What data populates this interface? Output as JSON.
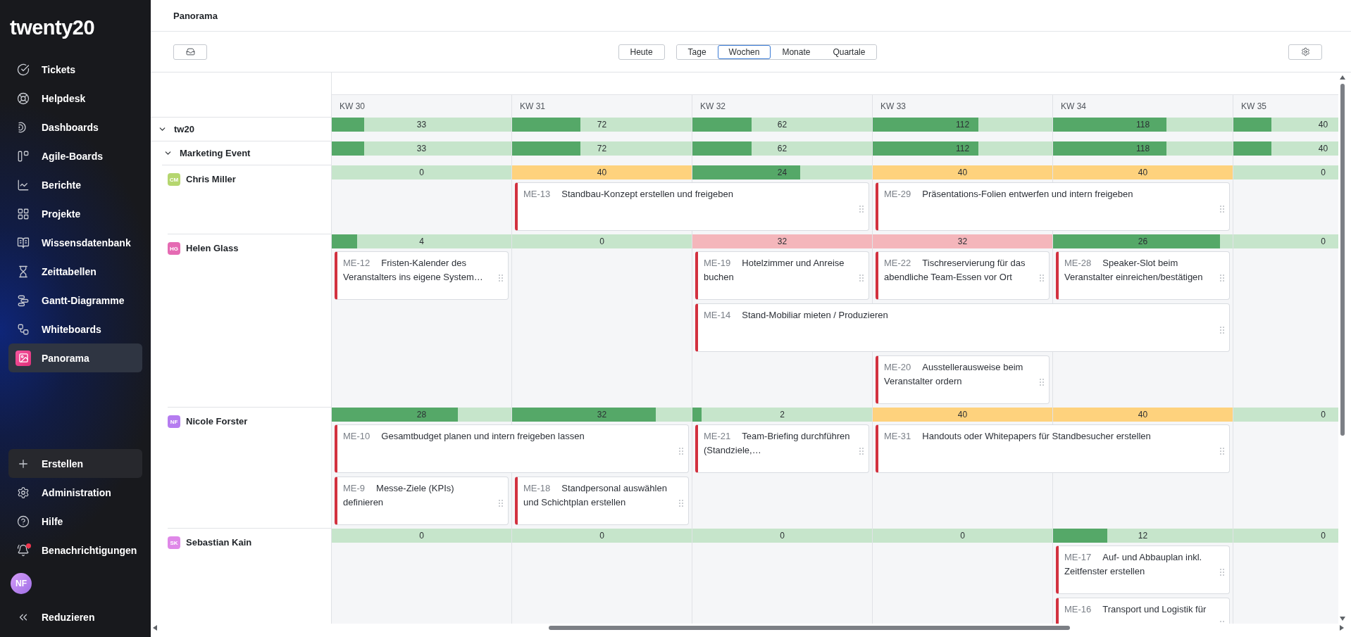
{
  "sidebar": {
    "logo": "twenty20",
    "nav": [
      {
        "label": "Tickets",
        "selected": false
      },
      {
        "label": "Helpdesk",
        "selected": false
      },
      {
        "label": "Dashboards",
        "selected": false
      },
      {
        "label": "Agile-Boards",
        "selected": false
      },
      {
        "label": "Berichte",
        "selected": false
      },
      {
        "label": "Projekte",
        "selected": false
      },
      {
        "label": "Wissensdatenbank",
        "selected": false
      },
      {
        "label": "Zeittabellen",
        "selected": false
      },
      {
        "label": "Gantt-Diagramme",
        "selected": false
      },
      {
        "label": "Whiteboards",
        "selected": false
      },
      {
        "label": "Panorama",
        "selected": true
      }
    ],
    "footer": [
      {
        "kind": "create",
        "label": "Erstellen",
        "unread": false
      },
      {
        "kind": "link",
        "label": "Administration",
        "unread": false
      },
      {
        "kind": "link",
        "label": "Hilfe",
        "unread": false
      },
      {
        "kind": "link",
        "label": "Benachrichtigungen",
        "unread": true
      }
    ],
    "user": {
      "initials": "NF"
    },
    "collapse": {
      "label": "Reduzieren"
    }
  },
  "header": {
    "title": "Panorama"
  },
  "toolbar": {
    "today": "Heute",
    "scales": [
      {
        "label": "Tage",
        "selected": false
      },
      {
        "label": "Wochen",
        "selected": true
      },
      {
        "label": "Monate",
        "selected": false
      },
      {
        "label": "Quartale",
        "selected": false
      }
    ]
  },
  "timeline": {
    "weeks": [
      "KW 30",
      "KW 31",
      "KW 32",
      "KW 33",
      "KW 34",
      "KW 35"
    ],
    "tree": [
      {
        "kind": "group",
        "label": "tw20",
        "expanded": true,
        "load": [
          {
            "value": "33",
            "color": "#c6e5cb",
            "level": 0.18
          },
          {
            "value": "72",
            "color": "#c6e5cb",
            "level": 0.38
          },
          {
            "value": "62",
            "color": "#c6e5cb",
            "level": 0.33
          },
          {
            "value": "112",
            "color": "#c6e5cb",
            "level": 0.59
          },
          {
            "value": "118",
            "color": "#c6e5cb",
            "level": 0.63
          },
          {
            "value": "40",
            "color": "#c6e5cb",
            "level": 0.21
          }
        ],
        "children": [
          {
            "kind": "group",
            "label": "Marketing Event",
            "expanded": true,
            "load": [
              {
                "value": "33",
                "color": "#c6e5cb",
                "level": 0.18
              },
              {
                "value": "72",
                "color": "#c6e5cb",
                "level": 0.38
              },
              {
                "value": "62",
                "color": "#c6e5cb",
                "level": 0.33
              },
              {
                "value": "112",
                "color": "#c6e5cb",
                "level": 0.59
              },
              {
                "value": "118",
                "color": "#c6e5cb",
                "level": 0.63
              },
              {
                "value": "40",
                "color": "#c6e5cb",
                "level": 0.21
              }
            ],
            "children": [
              {
                "kind": "person",
                "name": "Chris Miller",
                "initials": "CM",
                "color": "#b5d66f",
                "load": [
                  {
                    "value": "0",
                    "color": "#c6e5cb"
                  },
                  {
                    "value": "40",
                    "color": "#fed27d"
                  },
                  {
                    "value": "24",
                    "color": "#c6e5cb",
                    "level": 0.6
                  },
                  {
                    "value": "40",
                    "color": "#fed27d"
                  },
                  {
                    "value": "40",
                    "color": "#fed27d"
                  },
                  {
                    "value": "0",
                    "color": "#c6e5cb"
                  }
                ],
                "lanes": [
                  [
                    {
                      "kind": "empty"
                    },
                    {
                      "kind": "task",
                      "key": "ME-13",
                      "title": "Standbau-Konzept erstellen und freigeben"
                    },
                    {
                      "kind": "continued"
                    },
                    {
                      "kind": "task",
                      "key": "ME-29",
                      "title": "Präsentations-Folien entwerfen und intern freigeben"
                    },
                    {
                      "kind": "continued"
                    }
                  ]
                ]
              },
              {
                "kind": "person",
                "name": "Helen Glass",
                "initials": "HG",
                "color": "#e56bb3",
                "load": [
                  {
                    "value": "4",
                    "color": "#c6e5cb",
                    "level": 0.14
                  },
                  {
                    "value": "0",
                    "color": "#c6e5cb"
                  },
                  {
                    "value": "32",
                    "color": "#f4b6bb"
                  },
                  {
                    "value": "32",
                    "color": "#f4b6bb"
                  },
                  {
                    "value": "26",
                    "color": "#c6e5cb",
                    "level": 0.93
                  },
                  {
                    "value": "0",
                    "color": "#c6e5cb"
                  }
                ],
                "lanes": [
                  [
                    {
                      "kind": "task",
                      "key": "ME-12",
                      "title": "Fristen-Kalender des Veranstalters ins eigene System…"
                    },
                    {
                      "kind": "empty"
                    },
                    {
                      "kind": "task",
                      "key": "ME-19",
                      "title": "Hotelzimmer und Anreise buchen"
                    },
                    {
                      "kind": "task",
                      "key": "ME-22",
                      "title": "Tischreservierung für das abendliche Team-Essen vor Ort"
                    },
                    {
                      "kind": "task",
                      "key": "ME-28",
                      "title": "Speaker-Slot beim Veranstalter einreichen/bestätigen"
                    }
                  ],
                  [
                    {
                      "kind": "empty"
                    },
                    {
                      "kind": "empty"
                    },
                    {
                      "kind": "task",
                      "key": "ME-14",
                      "title": "Stand-Mobiliar mieten / Produzieren"
                    },
                    {
                      "kind": "continued"
                    },
                    {
                      "kind": "continued"
                    }
                  ],
                  [
                    {
                      "kind": "empty"
                    },
                    {
                      "kind": "empty"
                    },
                    {
                      "kind": "empty"
                    },
                    {
                      "kind": "task",
                      "key": "ME-20",
                      "title": "Ausstellerausweise beim Veranstalter ordern"
                    }
                  ]
                ]
              },
              {
                "kind": "person",
                "name": "Nicole Forster",
                "initials": "NF",
                "color": "#b57cf0",
                "load": [
                  {
                    "value": "28",
                    "color": "#c6e5cb",
                    "level": 0.7
                  },
                  {
                    "value": "32",
                    "color": "#c6e5cb",
                    "level": 0.8
                  },
                  {
                    "value": "2",
                    "color": "#c6e5cb",
                    "level": 0.05
                  },
                  {
                    "value": "40",
                    "color": "#fed27d"
                  },
                  {
                    "value": "40",
                    "color": "#fed27d"
                  },
                  {
                    "value": "0",
                    "color": "#c6e5cb"
                  }
                ],
                "lanes": [
                  [
                    {
                      "kind": "task",
                      "key": "ME-10",
                      "title": "Gesamtbudget planen und intern freigeben lassen"
                    },
                    {
                      "kind": "continued"
                    },
                    {
                      "kind": "task",
                      "key": "ME-21",
                      "title": "Team-Briefing durchführen (Standziele,…"
                    },
                    {
                      "kind": "task",
                      "key": "ME-31",
                      "title": "Handouts oder Whitepapers für Standbesucher erstellen"
                    },
                    {
                      "kind": "continued"
                    }
                  ],
                  [
                    {
                      "kind": "task",
                      "key": "ME-9",
                      "title": "Messe-Ziele (KPIs) definieren"
                    },
                    {
                      "kind": "task",
                      "key": "ME-18",
                      "title": "Standpersonal auswählen und Schichtplan erstellen"
                    }
                  ]
                ]
              },
              {
                "kind": "person",
                "name": "Sebastian Kain",
                "initials": "SK",
                "color": "#df88e8",
                "load": [
                  {
                    "value": "0",
                    "color": "#c6e5cb"
                  },
                  {
                    "value": "0",
                    "color": "#c6e5cb"
                  },
                  {
                    "value": "0",
                    "color": "#c6e5cb"
                  },
                  {
                    "value": "0",
                    "color": "#c6e5cb"
                  },
                  {
                    "value": "12",
                    "color": "#c6e5cb",
                    "level": 0.3
                  },
                  {
                    "value": "0",
                    "color": "#c6e5cb"
                  }
                ],
                "lanes": [
                  [
                    {
                      "kind": "empty"
                    },
                    {
                      "kind": "empty"
                    },
                    {
                      "kind": "empty"
                    },
                    {
                      "kind": "empty"
                    },
                    {
                      "kind": "task",
                      "key": "ME-17",
                      "title": "Auf- und Abbauplan inkl. Zeitfenster erstellen"
                    }
                  ],
                  [
                    {
                      "kind": "empty"
                    },
                    {
                      "kind": "empty"
                    },
                    {
                      "kind": "empty"
                    },
                    {
                      "kind": "empty"
                    },
                    {
                      "kind": "task",
                      "key": "ME-16",
                      "title": "Transport und Logistik für"
                    }
                  ]
                ]
              }
            ]
          }
        ]
      }
    ]
  }
}
